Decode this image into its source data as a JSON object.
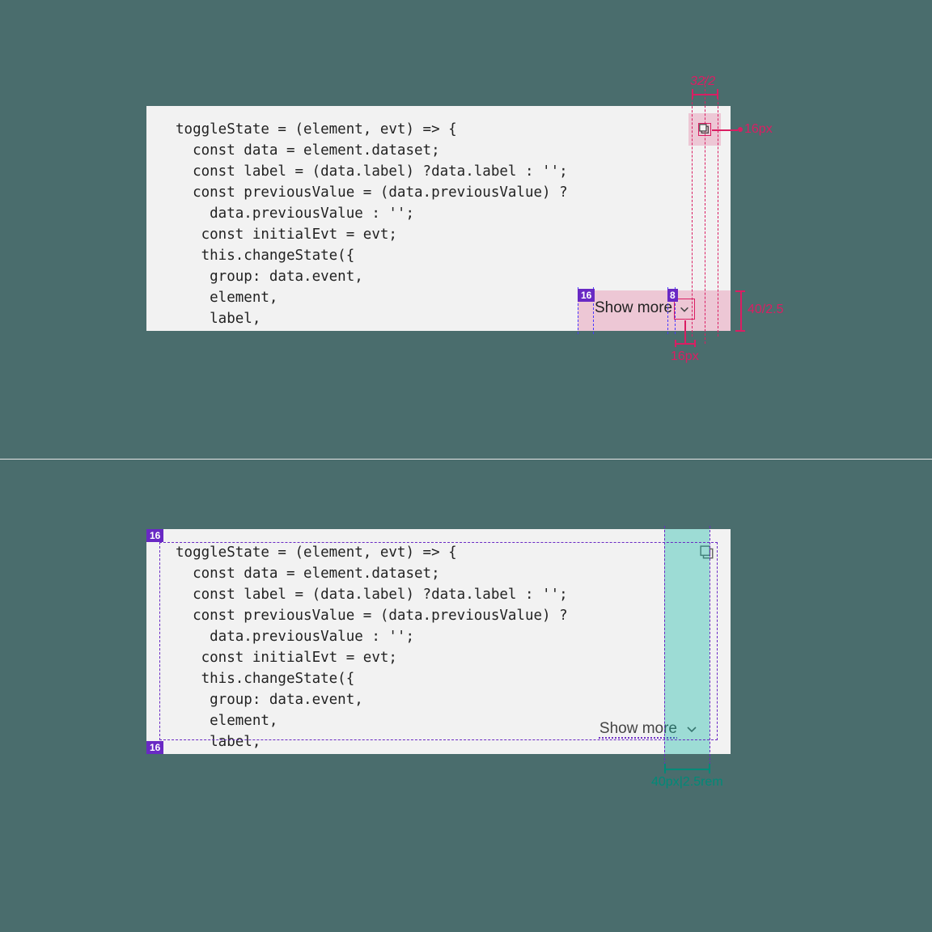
{
  "code_lines": [
    "toggleState = (element, evt) => {",
    "  const data = element.dataset;",
    "  const label = (data.label) ?data.label : '';",
    "  const previousValue = (data.previousValue) ?",
    "    data.previousValue : '';",
    "   const initialEvt = evt;",
    "   this.changeState({",
    "    group: data.event,",
    "    element,",
    "    label,"
  ],
  "top": {
    "show_more": "Show more",
    "annot_top": "32/2",
    "annot_copy_size": "16px",
    "annot_height": "40/2.5",
    "annot_chev_size": "16px",
    "badge_left": "16",
    "badge_right": "8"
  },
  "bottom": {
    "show_more": "Show more",
    "badge_top": "16",
    "badge_bottom": "16",
    "annot_band": "40px|2.5rem"
  }
}
